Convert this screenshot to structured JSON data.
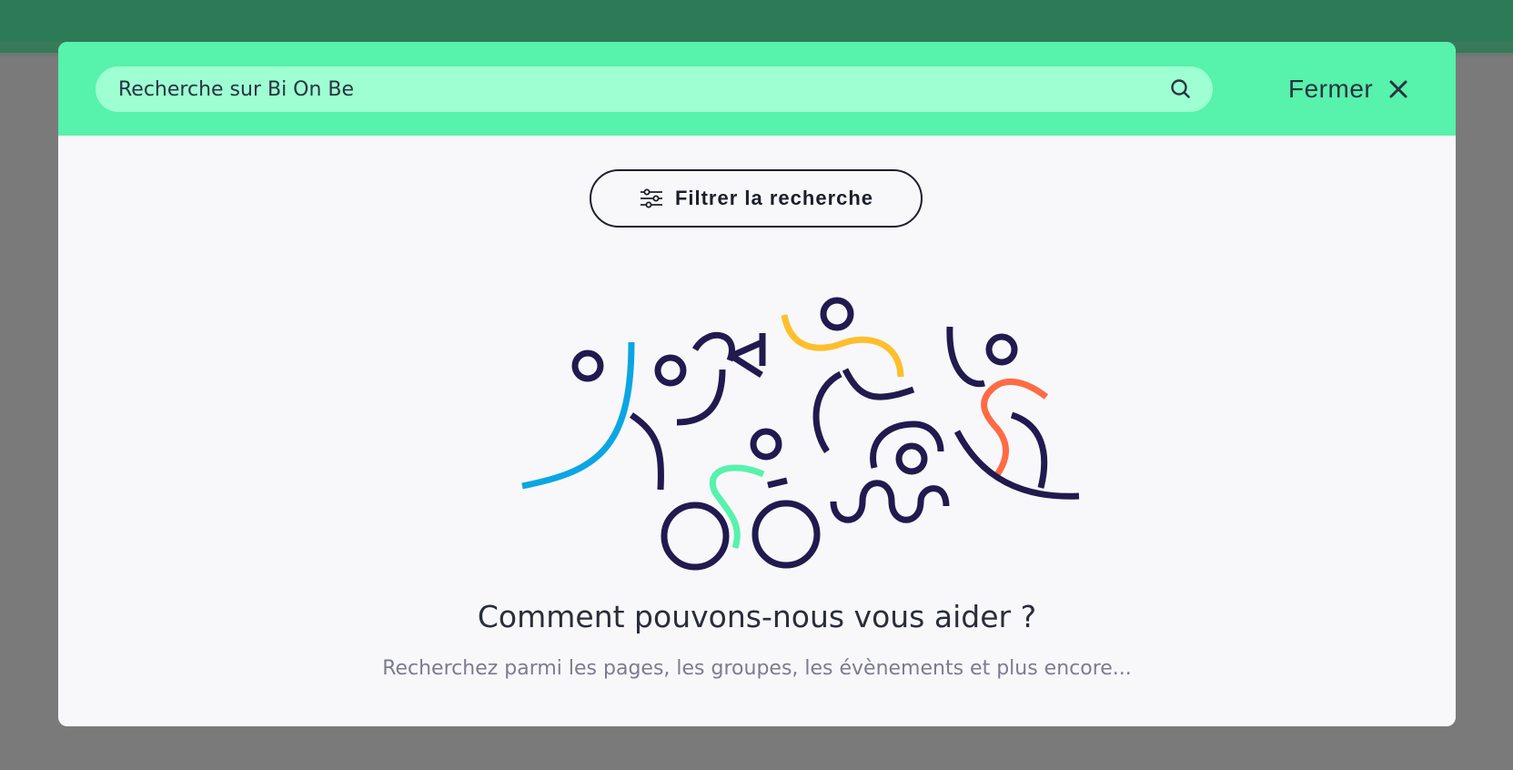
{
  "search": {
    "placeholder": "Recherche sur Bi On Be",
    "value": ""
  },
  "header": {
    "close_label": "Fermer"
  },
  "filter": {
    "label": "Filtrer la recherche"
  },
  "empty_state": {
    "title": "Comment pouvons-nous vous aider ?",
    "subtitle": "Recherchez parmi les pages, les groupes, les évènements et plus encore..."
  },
  "colors": {
    "header_bg": "#57f2ab",
    "search_bg": "#9effd3",
    "modal_bg": "#f8f8fb",
    "overlay": "#7a7a7a",
    "illustration_navy": "#211a4f",
    "illustration_blue": "#0aa6e3",
    "illustration_yellow": "#fdbf2c",
    "illustration_orange": "#ff6b45",
    "illustration_green": "#57f2ab"
  },
  "icons": {
    "search": "search-icon",
    "close": "close-icon",
    "filter": "sliders-icon"
  }
}
